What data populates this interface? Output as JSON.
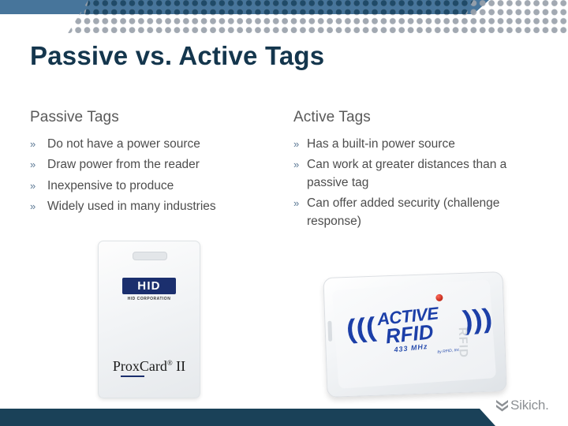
{
  "slide": {
    "title": "Passive vs. Active Tags",
    "accent_blue_top": "#47759b",
    "accent_blue_bottom": "#1a4158",
    "title_color": "#14364d",
    "body_text_color": "#4d4d4d",
    "heading_color": "#595959",
    "bullet_marker": "»"
  },
  "columns": {
    "passive": {
      "heading": "Passive Tags",
      "bullets": [
        "Do not have a power source",
        "Draw power from the reader",
        "Inexpensive to produce",
        "Widely used in many industries"
      ]
    },
    "active": {
      "heading": "Active Tags",
      "bullets": [
        "Has a built-in power source",
        "Can work at greater distances than a passive tag",
        "Can offer added security (challenge response)"
      ]
    }
  },
  "images": {
    "passive_card": {
      "name": "hid-proxcard-ii-badge",
      "logo_text": "HID",
      "logo_subtext": "HID CORPORATION",
      "product_name": "ProxCard",
      "product_registered": "®",
      "product_version": "II",
      "logo_box_color": "#1b2f6e"
    },
    "active_tag": {
      "name": "active-rfid-433mhz-tag",
      "brand_line1": "ACTIVE",
      "brand_line2": "RFID",
      "frequency": "433 MHz",
      "attribution": "by RFID, Inc.",
      "side_label": "RFID",
      "wave_glyph": ")))",
      "wave_glyph_left": "(((",
      "logo_color": "#1c3fa8",
      "led_color": "#c02718"
    }
  },
  "branding": {
    "logo_text": "Sikich.",
    "logo_color": "#8c9094"
  }
}
